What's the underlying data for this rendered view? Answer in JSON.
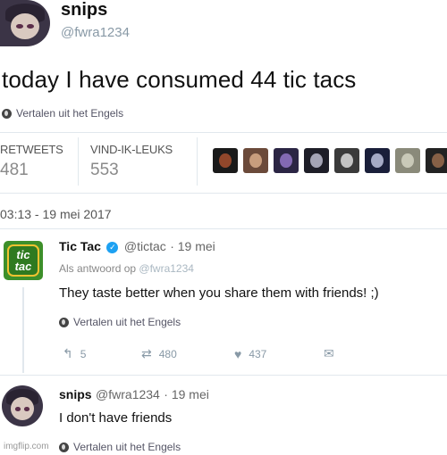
{
  "main_tweet": {
    "author_name": "snips",
    "author_handle": "@fwra1234",
    "text": "today I have consumed 44 tic tacs",
    "translate_label": "Vertalen uit het Engels",
    "stats": {
      "retweets_label": "RETWEETS",
      "retweets_value": "481",
      "likes_label": "VIND-IK-LEUKS",
      "likes_value": "553"
    },
    "liker_avatars": [
      {
        "name": "liker-1",
        "bg": "#1a1a1a",
        "fg": "#b0522f"
      },
      {
        "name": "liker-2",
        "bg": "#6b4a3a",
        "fg": "#e0b28e"
      },
      {
        "name": "liker-3",
        "bg": "#2b2544",
        "fg": "#9a7bd0"
      },
      {
        "name": "liker-4",
        "bg": "#1e1e28",
        "fg": "#c5c5d8"
      },
      {
        "name": "liker-5",
        "bg": "#3a3a3a",
        "fg": "#e6e6e6"
      },
      {
        "name": "liker-6",
        "bg": "#1a1f3a",
        "fg": "#c8cde8"
      },
      {
        "name": "liker-7",
        "bg": "#8a8a7a",
        "fg": "#d8d8c8"
      },
      {
        "name": "liker-8",
        "bg": "#222222",
        "fg": "#a07050"
      }
    ],
    "timestamp": "03:13 - 19 mei 2017"
  },
  "reply_1": {
    "author_name": "Tic Tac",
    "verified_glyph": "✓",
    "author_handle": "@tictac",
    "date": "· 19 mei",
    "reply_to_label": "Als antwoord op",
    "reply_to_handle": "@fwra1234",
    "text": "They taste better when you share them with friends! ;)",
    "translate_label": "Vertalen uit het Engels",
    "logo_line1": "tic",
    "logo_line2": "tac",
    "actions": {
      "reply_count": "5",
      "retweet_count": "480",
      "like_count": "437"
    }
  },
  "reply_2": {
    "author_name": "snips",
    "author_handle": "@fwra1234",
    "date": "· 19 mei",
    "text": "I don't have friends",
    "translate_label": "Vertalen uit het Engels"
  },
  "watermark": "imgflip.com",
  "colors": {
    "verified": "#1da1f2",
    "tictac_green": "#3d8f2a",
    "muted": "#8899a6"
  }
}
